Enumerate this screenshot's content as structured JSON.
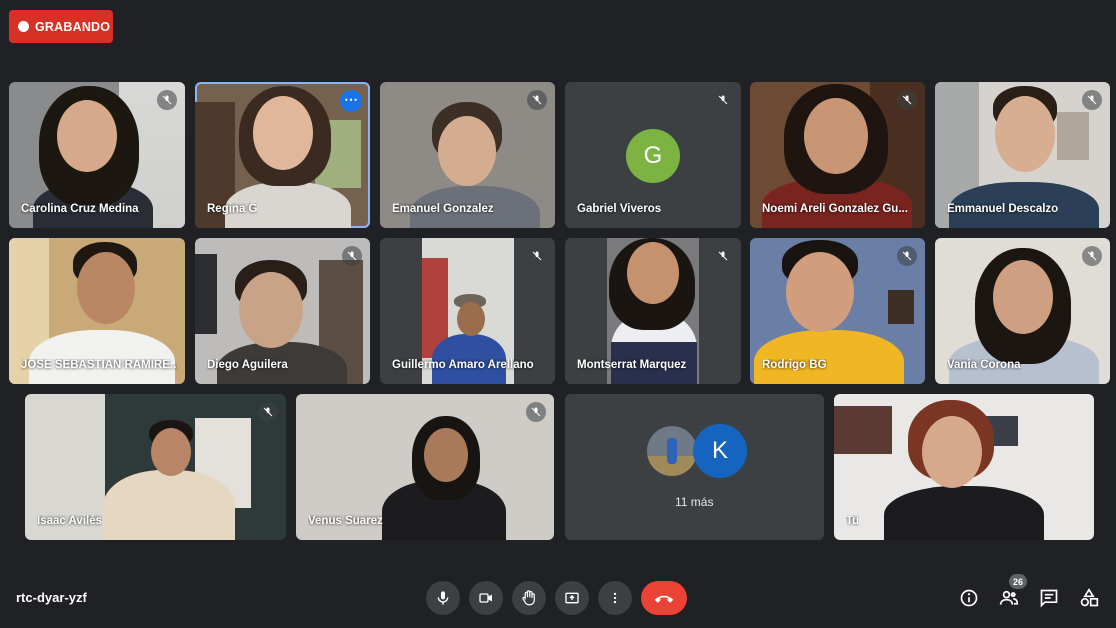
{
  "recording": {
    "label": "GRABANDO"
  },
  "participants": [
    {
      "name": "Carolina Cruz Medina"
    },
    {
      "name": "Regina G"
    },
    {
      "name": "Emanuel Gonzalez"
    },
    {
      "name": "Gabriel Viveros",
      "initial": "G"
    },
    {
      "name": "Noemi Areli Gonzalez Gu..."
    },
    {
      "name": "Emmanuel Descalzo"
    },
    {
      "name": "JOSE SEBASTIAN RAMIRE..."
    },
    {
      "name": "Diego Aguilera"
    },
    {
      "name": "Guillermo Amaro Arellano"
    },
    {
      "name": "Montserrat Marquez"
    },
    {
      "name": "Rodrigo BG"
    },
    {
      "name": "Vania Corona"
    },
    {
      "name": "Isaac Avilés"
    },
    {
      "name": "Venus Suarez"
    },
    {
      "name": "Tu"
    }
  ],
  "overflow": {
    "initial": "K",
    "label": "11 más"
  },
  "meeting": {
    "code": "rtc-dyar-yzf",
    "participant_count": "26"
  },
  "icons": {
    "more_options": "⋯",
    "mic": "mic-icon",
    "camera": "camera-icon",
    "hand": "raise-hand-icon",
    "present": "present-icon",
    "more": "more-vert-icon",
    "end": "end-call-icon",
    "info": "info-icon",
    "people": "people-icon",
    "chat": "chat-icon",
    "activities": "activities-icon"
  },
  "colors": {
    "recording": "#d93025",
    "end_call": "#ea4335",
    "avatar_g": "#7cb342",
    "avatar_k": "#1565c0",
    "active_border": "#8ab4f8"
  }
}
